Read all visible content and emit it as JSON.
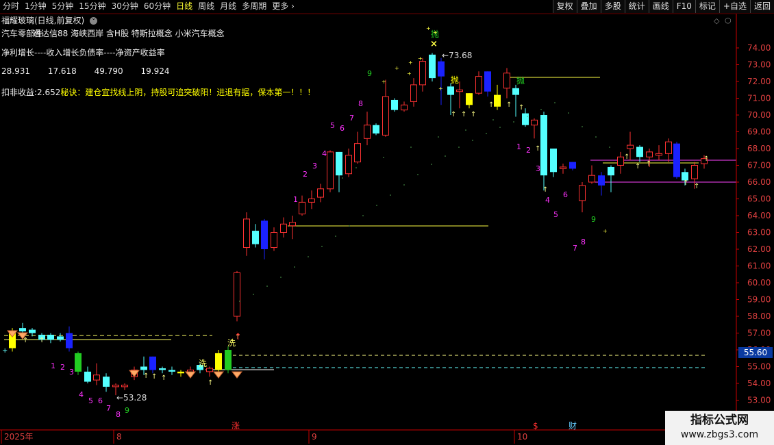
{
  "toolbar": {
    "periods": [
      "分时",
      "1分钟",
      "5分钟",
      "15分钟",
      "30分钟",
      "60分钟",
      "日线",
      "周线",
      "月线",
      "多周期"
    ],
    "active_period": "日线",
    "more_label": "更多",
    "right_buttons": [
      "复权",
      "叠加",
      "多股",
      "统计",
      "画线",
      "F10",
      "标记",
      "+自选",
      "返回"
    ]
  },
  "header": {
    "stock_title": "福耀玻璃(日线,前复权)",
    "concepts": "汽车零部件",
    "concepts_overlap": "通达信88 海峡西岸 含H股 特斯拉概念 小米汽车概念",
    "indicator_labels": "净利增长----收入增长负债率----净资产收益率",
    "indicator_values": [
      "28.931",
      "17.618",
      "49.790",
      "19.924"
    ],
    "eps_label": "扣非收益:",
    "eps_value": "2.652",
    "tip": "秘诀：建仓宜找线上阴，持股可追突破阳！进退有据，保本第一！！！"
  },
  "colors": {
    "up": "#ff3232",
    "down": "#54ffff",
    "blue": "#1a22ff",
    "yellow": "#ffff00",
    "green": "#22cc22",
    "magenta": "#ff33ff",
    "axis": "#cc0000"
  },
  "price_axis": {
    "ticks": [
      "74.00",
      "73.00",
      "72.00",
      "71.00",
      "70.00",
      "69.00",
      "68.00",
      "67.00",
      "66.00",
      "65.00",
      "64.00",
      "63.00",
      "62.00",
      "61.00",
      "60.00",
      "59.00",
      "58.00",
      "57.00",
      "56.00",
      "55.00",
      "54.00",
      "53.00"
    ],
    "current_price": "55.60"
  },
  "date_axis": {
    "labels": [
      "2025年",
      "8",
      "9",
      "10"
    ],
    "events": [
      "涨",
      "$",
      "财"
    ]
  },
  "annotations": {
    "high": "73.68",
    "low": "53.28",
    "sell_signal": "抛",
    "wash_signal": "洗"
  },
  "watermark": {
    "title": "指标公式网",
    "url": "www.zbgs3.com"
  }
}
